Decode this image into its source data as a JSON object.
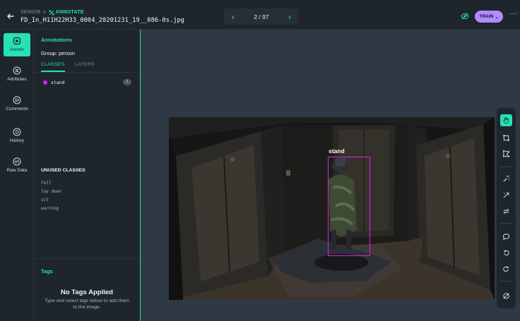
{
  "header": {
    "breadcrumb_parent": "SENIOR",
    "breadcrumb_separator": ">",
    "breadcrumb_current": "ANNOTATE",
    "filename": "FD_In_H11H22H33_0004_20201231_19__086-0s.jpg",
    "pager": {
      "prev_icon": "chevron-left-icon",
      "count": "2 / 97",
      "next_icon": "chevron-right-icon"
    },
    "train_label": "TRAIN",
    "more_label": "···"
  },
  "rail": {
    "items": [
      {
        "label": "Annots",
        "icon": "annotation-icon",
        "active": true
      },
      {
        "label": "Attributes",
        "icon": "list-icon",
        "active": false
      },
      {
        "label": "Comments",
        "icon": "comment-icon",
        "active": false
      },
      {
        "label": "History",
        "icon": "history-icon",
        "active": false
      },
      {
        "label": "Raw Data",
        "icon": "code-icon",
        "active": false
      }
    ]
  },
  "panel": {
    "title": "Annotations",
    "group_label": "Group: person",
    "tabs": [
      {
        "label": "CLASSES",
        "active": true
      },
      {
        "label": "LAYERS",
        "active": false
      }
    ],
    "classes": [
      {
        "name": "stand",
        "count": "1",
        "color": "#e020e6"
      }
    ],
    "unused_title": "UNUSED CLASSES",
    "unused_classes": [
      "fall",
      "lay down",
      "sit",
      "warning"
    ],
    "tags_title": "Tags",
    "no_tags_title": "No Tags Applied",
    "no_tags_hint": "Type and select tags below to add them to the image."
  },
  "canvas": {
    "annotation": {
      "label": "stand",
      "color": "#e020e6"
    }
  },
  "toolbar": {
    "tools": [
      "pan-hand-icon",
      "bounding-box-icon",
      "polygon-icon",
      "magic-wand-icon",
      "smart-select-icon",
      "convert-icon",
      "comment-icon",
      "undo-icon",
      "redo-icon",
      "hide-icon"
    ]
  },
  "colors": {
    "accent": "#27e0b6",
    "train": "#b18cff",
    "class_stand": "#e020e6"
  }
}
